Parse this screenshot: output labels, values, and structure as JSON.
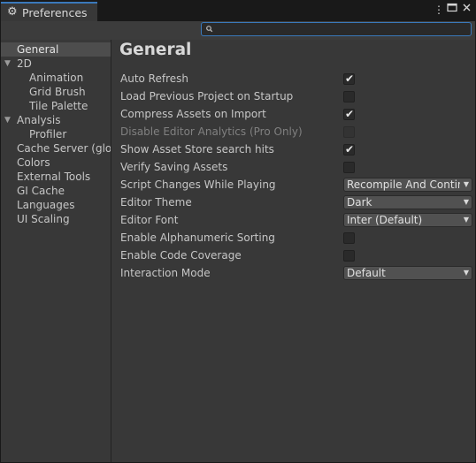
{
  "window": {
    "title": "Preferences",
    "tab_icon": "gear-icon",
    "menu_icon": "more-vertical-icon",
    "maximize_icon": "maximize-icon",
    "close_icon": "close-icon"
  },
  "search": {
    "value": "",
    "placeholder": ""
  },
  "sidebar": {
    "items": [
      {
        "label": "General",
        "selected": true
      },
      {
        "label": "2D",
        "expanded": true
      },
      {
        "label": "Animation"
      },
      {
        "label": "Grid Brush"
      },
      {
        "label": "Tile Palette"
      },
      {
        "label": "Analysis",
        "expanded": true
      },
      {
        "label": "Profiler"
      },
      {
        "label": "Cache Server (global)"
      },
      {
        "label": "Colors"
      },
      {
        "label": "External Tools"
      },
      {
        "label": "GI Cache"
      },
      {
        "label": "Languages"
      },
      {
        "label": "UI Scaling"
      }
    ]
  },
  "main": {
    "title": "General",
    "settings": [
      {
        "label": "Auto Refresh",
        "type": "checkbox",
        "checked": true
      },
      {
        "label": "Load Previous Project on Startup",
        "type": "checkbox",
        "checked": false
      },
      {
        "label": "Compress Assets on Import",
        "type": "checkbox",
        "checked": true
      },
      {
        "label": "Disable Editor Analytics (Pro Only)",
        "type": "checkbox",
        "checked": false,
        "disabled": true
      },
      {
        "label": "Show Asset Store search hits",
        "type": "checkbox",
        "checked": true
      },
      {
        "label": "Verify Saving Assets",
        "type": "checkbox",
        "checked": false
      },
      {
        "label": "Script Changes While Playing",
        "type": "dropdown",
        "value": "Recompile And Continue Playing"
      },
      {
        "label": "Editor Theme",
        "type": "dropdown",
        "value": "Dark"
      },
      {
        "label": "Editor Font",
        "type": "dropdown",
        "value": "Inter (Default)"
      },
      {
        "label": "Enable Alphanumeric Sorting",
        "type": "checkbox",
        "checked": false
      },
      {
        "label": "Enable Code Coverage",
        "type": "checkbox",
        "checked": false
      },
      {
        "label": "Interaction Mode",
        "type": "dropdown",
        "value": "Default"
      }
    ]
  },
  "colors": {
    "accent": "#3a79bb",
    "background": "#383838",
    "selected": "#4d4d4d"
  }
}
